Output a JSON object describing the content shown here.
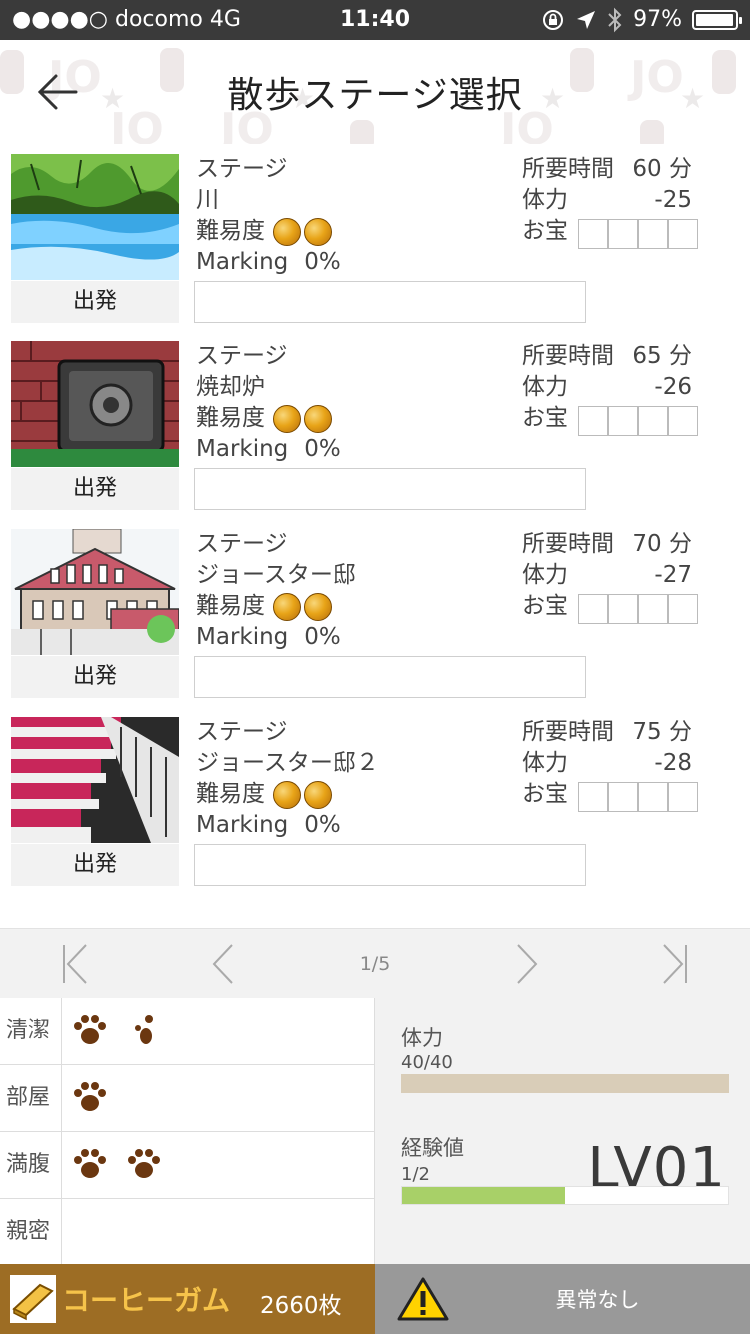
{
  "status_bar": {
    "carrier": "●●●●○ docomo   4G",
    "time": "11:40",
    "battery": "97%",
    "battery_level": 0.97
  },
  "header": {
    "title": "散歩ステージ選択"
  },
  "stages": [
    {
      "label": "ステージ",
      "name": "川",
      "difficulty_label": "難易度",
      "marking_label": "Marking",
      "marking_value": "0%",
      "time_label": "所要時間",
      "time_value": "60 分",
      "stamina_label": "体力",
      "stamina_value": "-25",
      "treasure_label": "お宝",
      "depart_label": "出発",
      "difficulty_coins": 2
    },
    {
      "label": "ステージ",
      "name": "焼却炉",
      "difficulty_label": "難易度",
      "marking_label": "Marking",
      "marking_value": "0%",
      "time_label": "所要時間",
      "time_value": "65 分",
      "stamina_label": "体力",
      "stamina_value": "-26",
      "treasure_label": "お宝",
      "depart_label": "出発",
      "difficulty_coins": 2
    },
    {
      "label": "ステージ",
      "name": "ジョースター邸",
      "difficulty_label": "難易度",
      "marking_label": "Marking",
      "marking_value": "0%",
      "time_label": "所要時間",
      "time_value": "70 分",
      "stamina_label": "体力",
      "stamina_value": "-27",
      "treasure_label": "お宝",
      "depart_label": "出発",
      "difficulty_coins": 2
    },
    {
      "label": "ステージ",
      "name": "ジョースター邸２",
      "difficulty_label": "難易度",
      "marking_label": "Marking",
      "marking_value": "0%",
      "time_label": "所要時間",
      "time_value": "75 分",
      "stamina_label": "体力",
      "stamina_value": "-28",
      "treasure_label": "お宝",
      "depart_label": "出発",
      "difficulty_coins": 2
    }
  ],
  "pager": {
    "page": "1/5"
  },
  "stats": {
    "items": [
      {
        "label": "清潔",
        "paws": 2
      },
      {
        "label": "部屋",
        "paws": 1
      },
      {
        "label": "満腹",
        "paws": 2
      },
      {
        "label": "親密",
        "paws": 0
      }
    ],
    "stamina_label": "体力",
    "stamina_value": "40/40",
    "stamina_fraction": 1.0,
    "exp_label": "経験値",
    "exp_value": "1/2",
    "exp_fraction": 0.5,
    "level": "LV01"
  },
  "bottom": {
    "gum_name": "コーヒーガム",
    "gum_count": "2660枚",
    "condition": "異常なし"
  },
  "colors": {
    "accent_gold": "#f6c34a",
    "gum_bar_bg": "#9d6d24",
    "exp_fill": "#a8d068",
    "stamina_fill": "#d9cdb8",
    "paw": "#6b3710"
  }
}
